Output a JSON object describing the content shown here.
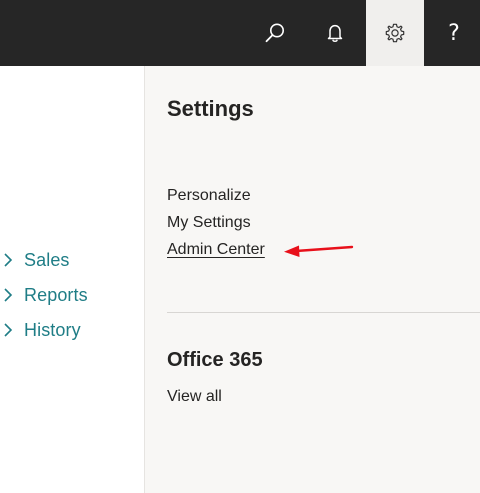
{
  "topbar": {
    "icons": [
      "search-icon",
      "bell-icon",
      "gear-icon",
      "help-icon"
    ],
    "help_glyph": "?",
    "active_icon": "gear-icon",
    "background": "#262626",
    "active_background": "#f0efed"
  },
  "nav": {
    "items": [
      {
        "label": "Sales"
      },
      {
        "label": "Reports"
      },
      {
        "label": "History"
      }
    ],
    "color": "#1f7d86"
  },
  "settings_panel": {
    "title": "Settings",
    "links": [
      {
        "label": "Personalize"
      },
      {
        "label": "My Settings"
      },
      {
        "label": "Admin Center"
      }
    ],
    "office_section": {
      "title": "Office 365",
      "view_all": "View all"
    }
  },
  "annotation": {
    "arrow_color": "#e8101a",
    "points_to": "Admin Center"
  }
}
